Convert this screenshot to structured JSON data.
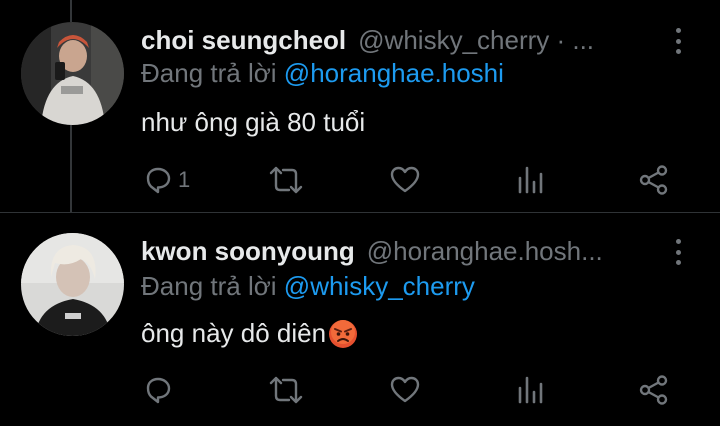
{
  "colors": {
    "background": "#000000",
    "text": "#e7e9ea",
    "muted": "#71767b",
    "link": "#1d9bf0"
  },
  "tweets": [
    {
      "display_name": "choi seungcheol",
      "handle": "@whisky_cherry · ...",
      "reply_prefix": "Đang trả lời",
      "reply_to": "@horanghae.hoshi",
      "text": "như ông già 80 tuổi",
      "reply_count": "1",
      "icons": [
        "reply-icon",
        "retweet-icon",
        "like-icon",
        "views-icon",
        "share-icon"
      ]
    },
    {
      "display_name": "kwon soonyoung",
      "handle": "@horanghae.hosh...",
      "reply_prefix": "Đang trả lời",
      "reply_to": "@whisky_cherry",
      "text": "ông này dô diên",
      "emoji": "angry-face-emoji",
      "reply_count": "",
      "icons": [
        "reply-icon",
        "retweet-icon",
        "like-icon",
        "views-icon",
        "share-icon"
      ]
    }
  ]
}
